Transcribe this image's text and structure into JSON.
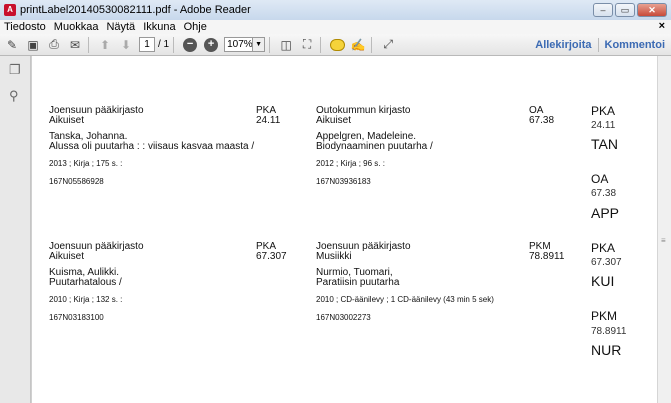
{
  "window": {
    "title": "printLabel20140530082111.pdf - Adobe Reader",
    "icon": "pdf-app-icon",
    "buttons": [
      "minimize",
      "maximize",
      "close"
    ]
  },
  "menu": {
    "items": [
      "Tiedosto",
      "Muokkaa",
      "Näytä",
      "Ikkuna",
      "Ohje"
    ],
    "close": "×"
  },
  "toolbar": {
    "page_current": "1",
    "page_total": "/ 1",
    "zoom": "107%",
    "sign_label": "Allekirjoita",
    "comment_label": "Kommentoi"
  },
  "labels": [
    {
      "library": "Joensuun pääkirjasto",
      "department": "Aikuiset",
      "class_code": "PKA",
      "class_num": "24.11",
      "author": "Tanska, Johanna.",
      "title": "Alussa oli puutarha : : viisaus kasvaa maasta /",
      "details": "2013 ; Kirja ; 175 s. :",
      "barcode": "167N05586928"
    },
    {
      "library": "Outokummun kirjasto",
      "department": "Aikuiset",
      "class_code": "OA",
      "class_num": "67.38",
      "author": "Appelgren, Madeleine.",
      "title": "Biodynaaminen puutarha /",
      "details": "2012 ; Kirja ; 96 s. :",
      "barcode": "167N03936183"
    },
    {
      "library": "Joensuun pääkirjasto",
      "department": "Aikuiset",
      "class_code": "PKA",
      "class_num": "67.307",
      "author": "Kuisma, Aulikki.",
      "title": "Puutarhatalous /",
      "details": "2010 ; Kirja ; 132 s. :",
      "barcode": "167N03183100"
    },
    {
      "library": "Joensuun pääkirjasto",
      "department": "Musiikki",
      "class_code": "PKM",
      "class_num": "78.8911",
      "author": "Nurmio, Tuomari,",
      "title": "Paratiisin puutarha",
      "details": "2010 ; CD-äänilevy ; 1 CD-äänilevy (43 min 5 sek)",
      "barcode": "167N03002273"
    }
  ],
  "spine": [
    {
      "code": "PKA",
      "num": "24.11",
      "name": "TAN"
    },
    {
      "code": "OA",
      "num": "67.38",
      "name": "APP"
    },
    {
      "code": "PKA",
      "num": "67.307",
      "name": "KUI"
    },
    {
      "code": "PKM",
      "num": "78.8911",
      "name": "NUR"
    }
  ]
}
